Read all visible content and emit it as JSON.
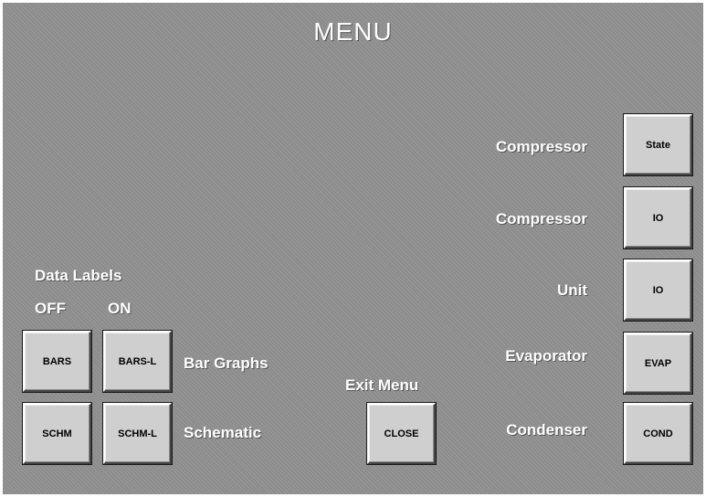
{
  "title": "MENU",
  "data_labels": {
    "heading": "Data Labels",
    "off": "OFF",
    "on": "ON"
  },
  "rows": {
    "bar_graphs": {
      "label": "Bar Graphs",
      "off_button": "BARS",
      "on_button": "BARS-L"
    },
    "schematic": {
      "label": "Schematic",
      "off_button": "SCHM",
      "on_button": "SCHM-L"
    }
  },
  "exit": {
    "label": "Exit Menu",
    "button": "CLOSE"
  },
  "right_menu": [
    {
      "label": "Compressor",
      "button": "State"
    },
    {
      "label": "Compressor",
      "button": "IO"
    },
    {
      "label": "Unit",
      "button": "IO"
    },
    {
      "label": "Evaporator",
      "button": "EVAP"
    },
    {
      "label": "Condenser",
      "button": "COND"
    }
  ]
}
